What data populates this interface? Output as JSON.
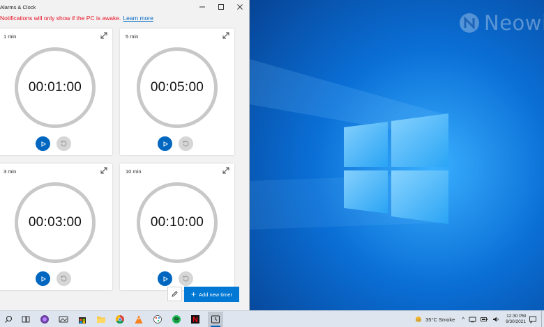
{
  "app": {
    "title": "Alarms & Clock",
    "notice": "Notifications will only show if the PC is awake.",
    "learn_more": "Learn more",
    "timers": [
      {
        "name": "1 min",
        "time": "00:01:00"
      },
      {
        "name": "5 min",
        "time": "00:05:00"
      },
      {
        "name": "3 min",
        "time": "00:03:00"
      },
      {
        "name": "10 min",
        "time": "00:10:00"
      }
    ],
    "add_timer_label": "Add new timer",
    "accent_color": "#0067c0"
  },
  "watermark": {
    "text": "Neowin"
  },
  "taskbar": {
    "icons": [
      "search-icon",
      "task-view-icon",
      "firefox-icon",
      "photos-icon",
      "store-icon",
      "file-explorer-icon",
      "chrome-icon",
      "vlc-icon",
      "paint-icon",
      "spotify-icon",
      "netflix-icon",
      "alarms-clock-icon"
    ],
    "weather": "35°C  Smoke",
    "time": "12:30 PM",
    "date": "9/30/2021"
  }
}
